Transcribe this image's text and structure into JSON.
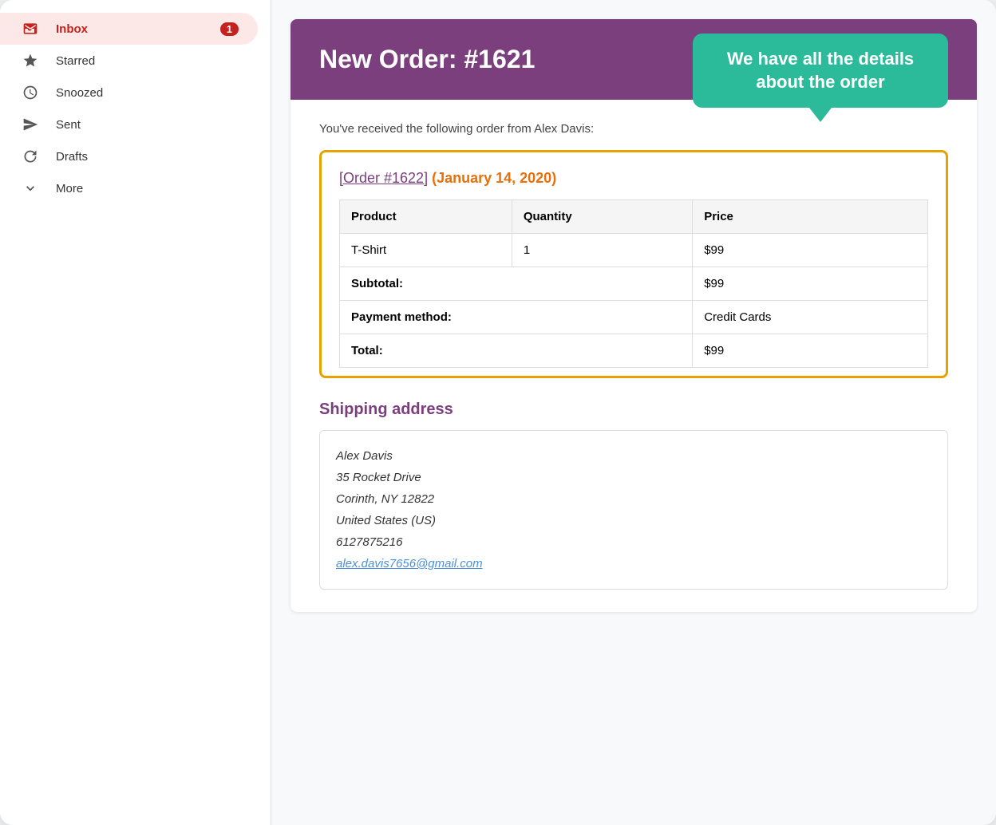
{
  "sidebar": {
    "items": [
      {
        "id": "inbox",
        "label": "Inbox",
        "icon": "inbox",
        "active": true,
        "badge": "1"
      },
      {
        "id": "starred",
        "label": "Starred",
        "icon": "star",
        "active": false,
        "badge": ""
      },
      {
        "id": "snoozed",
        "label": "Snoozed",
        "icon": "clock",
        "active": false,
        "badge": ""
      },
      {
        "id": "sent",
        "label": "Sent",
        "icon": "send",
        "active": false,
        "badge": ""
      },
      {
        "id": "drafts",
        "label": "Drafts",
        "icon": "drafts",
        "active": false,
        "badge": ""
      },
      {
        "id": "more",
        "label": "More",
        "icon": "chevron-down",
        "active": false,
        "badge": ""
      }
    ]
  },
  "email": {
    "header_title": "New Order: #1621",
    "tooltip_text": "We have all the details about the order",
    "intro_text": "You've received the following order from Alex Davis:",
    "order_link_text": "[Order #1622]",
    "order_date_text": "(January 14, 2020)",
    "table": {
      "columns": [
        "Product",
        "Quantity",
        "Price"
      ],
      "rows": [
        {
          "product": "T-Shirt",
          "quantity": "1",
          "price": "$99"
        }
      ],
      "subtotal_label": "Subtotal:",
      "subtotal_value": "$99",
      "payment_label": "Payment method:",
      "payment_value": "Credit Cards",
      "total_label": "Total:",
      "total_value": "$99"
    },
    "shipping_heading": "Shipping address",
    "address": {
      "name": "Alex Davis",
      "street": "35 Rocket Drive",
      "city_state": "Corinth, NY 12822",
      "country": "United States (US)",
      "phone": "6127875216",
      "email": "alex.davis7656@gmail.com"
    }
  },
  "colors": {
    "inbox_active_bg": "#fce8e6",
    "inbox_active_text": "#c5221f",
    "header_bg": "#7b3f7e",
    "tooltip_bg": "#2bba9a",
    "order_border": "#e8a200",
    "shipping_heading": "#7b3f7e",
    "order_link": "#7b3f7e",
    "order_date": "#e8700a"
  }
}
